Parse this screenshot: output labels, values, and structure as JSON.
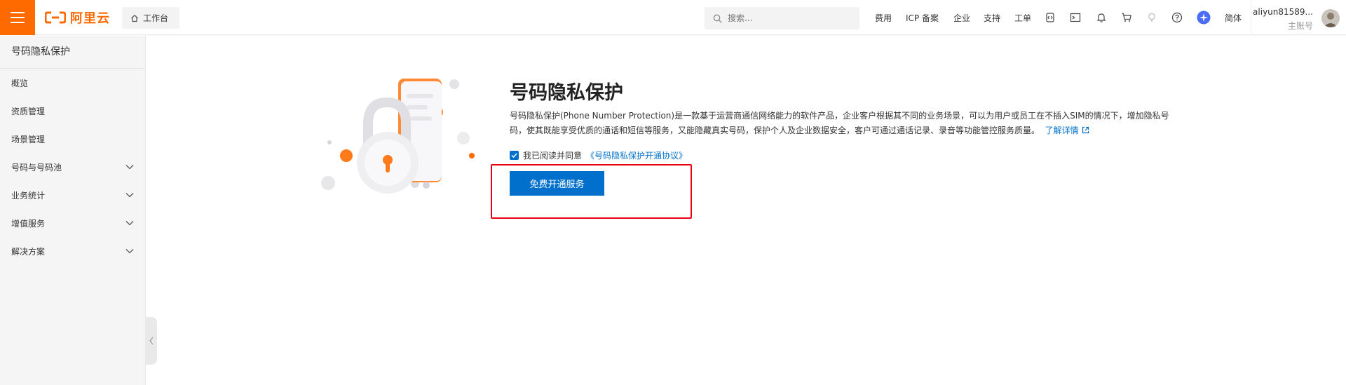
{
  "header": {
    "logo_text": "阿里云",
    "workbench_label": "工作台",
    "search_placeholder": "搜索...",
    "nav": [
      "费用",
      "ICP 备案",
      "企业",
      "支持",
      "工单"
    ],
    "language": "简体",
    "account_name": "aliyun81589...",
    "account_role": "主账号",
    "brand_color": "#ff6a00"
  },
  "sidebar": {
    "title": "号码隐私保护",
    "items": [
      {
        "label": "概览",
        "expandable": false
      },
      {
        "label": "资质管理",
        "expandable": false
      },
      {
        "label": "场景管理",
        "expandable": false
      },
      {
        "label": "号码与号码池",
        "expandable": true
      },
      {
        "label": "业务统计",
        "expandable": true
      },
      {
        "label": "增值服务",
        "expandable": true
      },
      {
        "label": "解决方案",
        "expandable": true
      }
    ]
  },
  "main": {
    "title": "号码隐私保护",
    "description": "号码隐私保护(Phone Number Protection)是一款基于运营商通信网络能力的软件产品，企业客户根据其不同的业务场景，可以为用户或员工在不插入SIM的情况下，增加隐私号码，使其既能享受优质的通话和短信等服务，又能隐藏真实号码，保护个人及企业数据安全，客户可通过通话记录、录音等功能管控服务质量。",
    "learn_more": "了解详情",
    "agree_prefix": "我已阅读并同意",
    "agreement_link": "《号码隐私保护开通协议》",
    "agree_checked": true,
    "primary_button": "免费开通服务",
    "accent_color": "#0070cc",
    "highlight_color": "#e60012"
  }
}
